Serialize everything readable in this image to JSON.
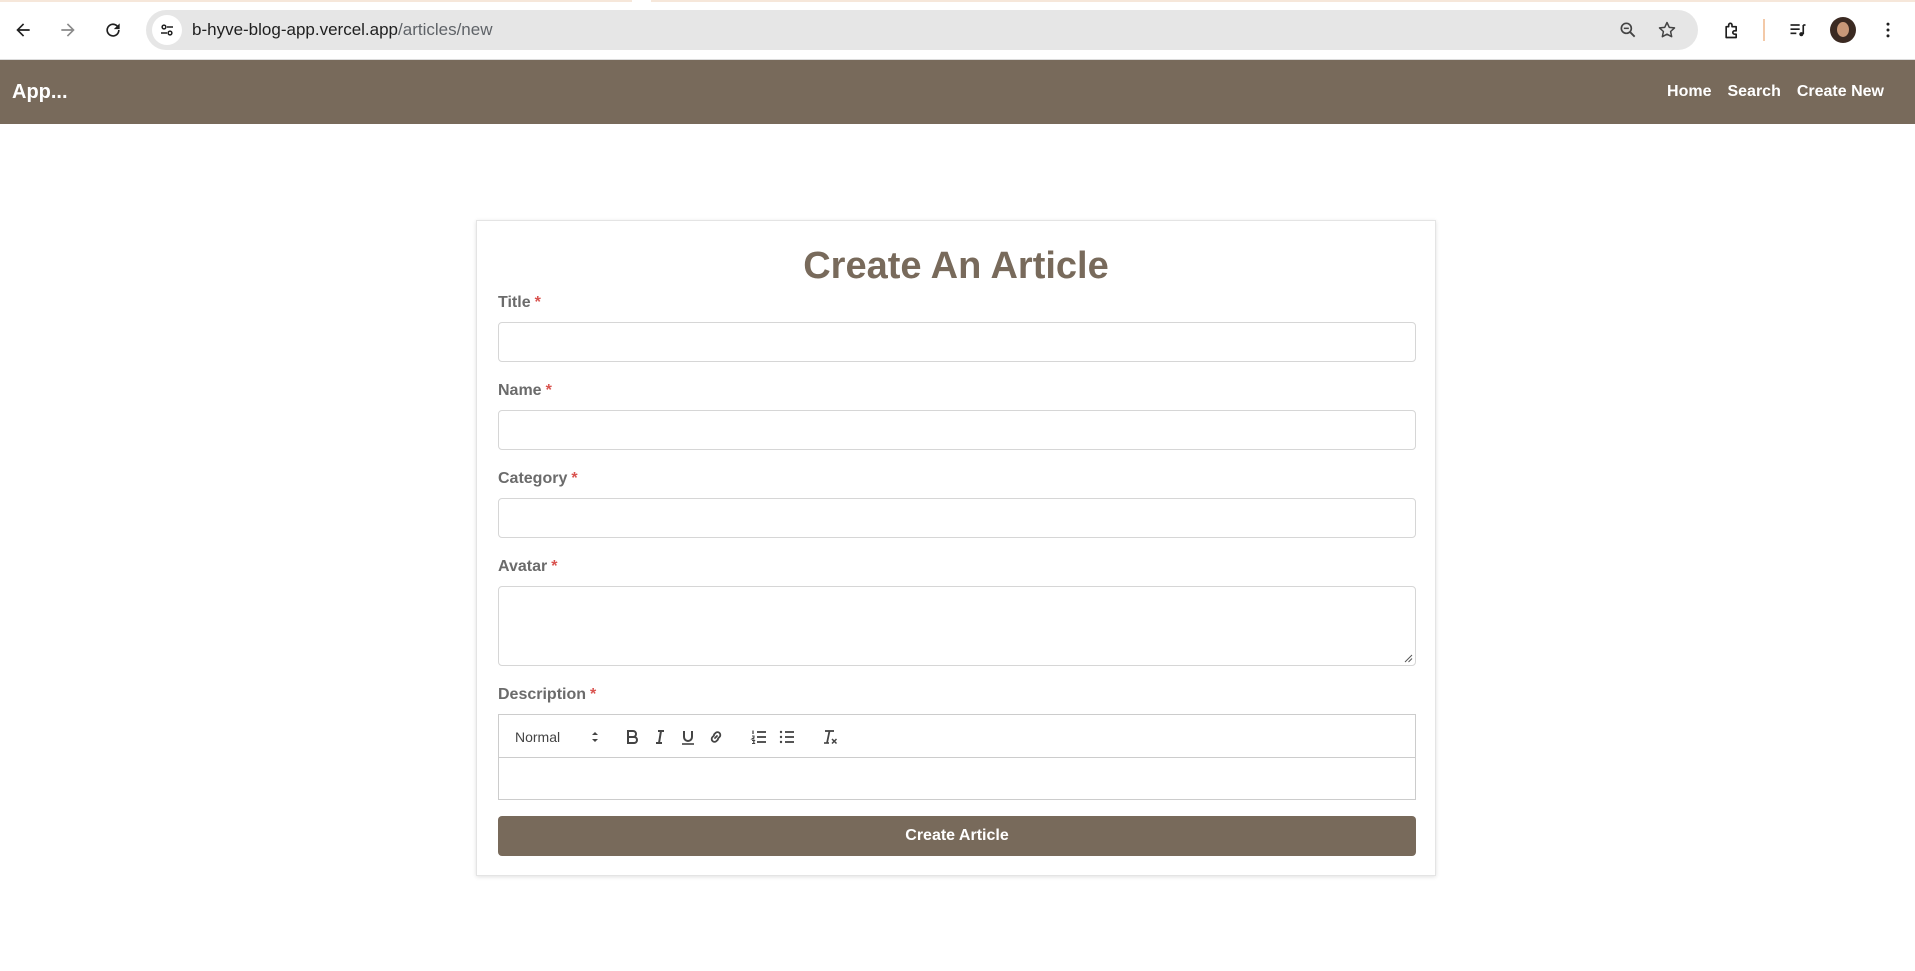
{
  "browser": {
    "url_host": "b-hyve-blog-app.vercel.app",
    "url_path": "/articles/new",
    "icons": [
      "back-arrow-icon",
      "forward-arrow-icon",
      "reload-icon",
      "site-info-icon",
      "zoom-icon",
      "bookmark-star-icon",
      "extensions-icon",
      "media-controls-icon",
      "profile-avatar",
      "more-menu-icon"
    ]
  },
  "navbar": {
    "brand": "App...",
    "links": [
      "Home",
      "Search",
      "Create New"
    ],
    "background": "#786a5b"
  },
  "form": {
    "title": "Create An Article",
    "required_marker": "*",
    "fields": {
      "title": {
        "label": "Title",
        "value": ""
      },
      "name": {
        "label": "Name",
        "value": ""
      },
      "category": {
        "label": "Category",
        "value": ""
      },
      "avatar": {
        "label": "Avatar",
        "value": ""
      },
      "description": {
        "label": "Description",
        "value": ""
      }
    },
    "editor_toolbar": {
      "heading_select": "Normal",
      "buttons": [
        "bold-icon",
        "italic-icon",
        "underline-icon",
        "link-icon",
        "ordered-list-icon",
        "bullet-list-icon",
        "clear-format-icon"
      ]
    },
    "submit_label": "Create Article"
  }
}
